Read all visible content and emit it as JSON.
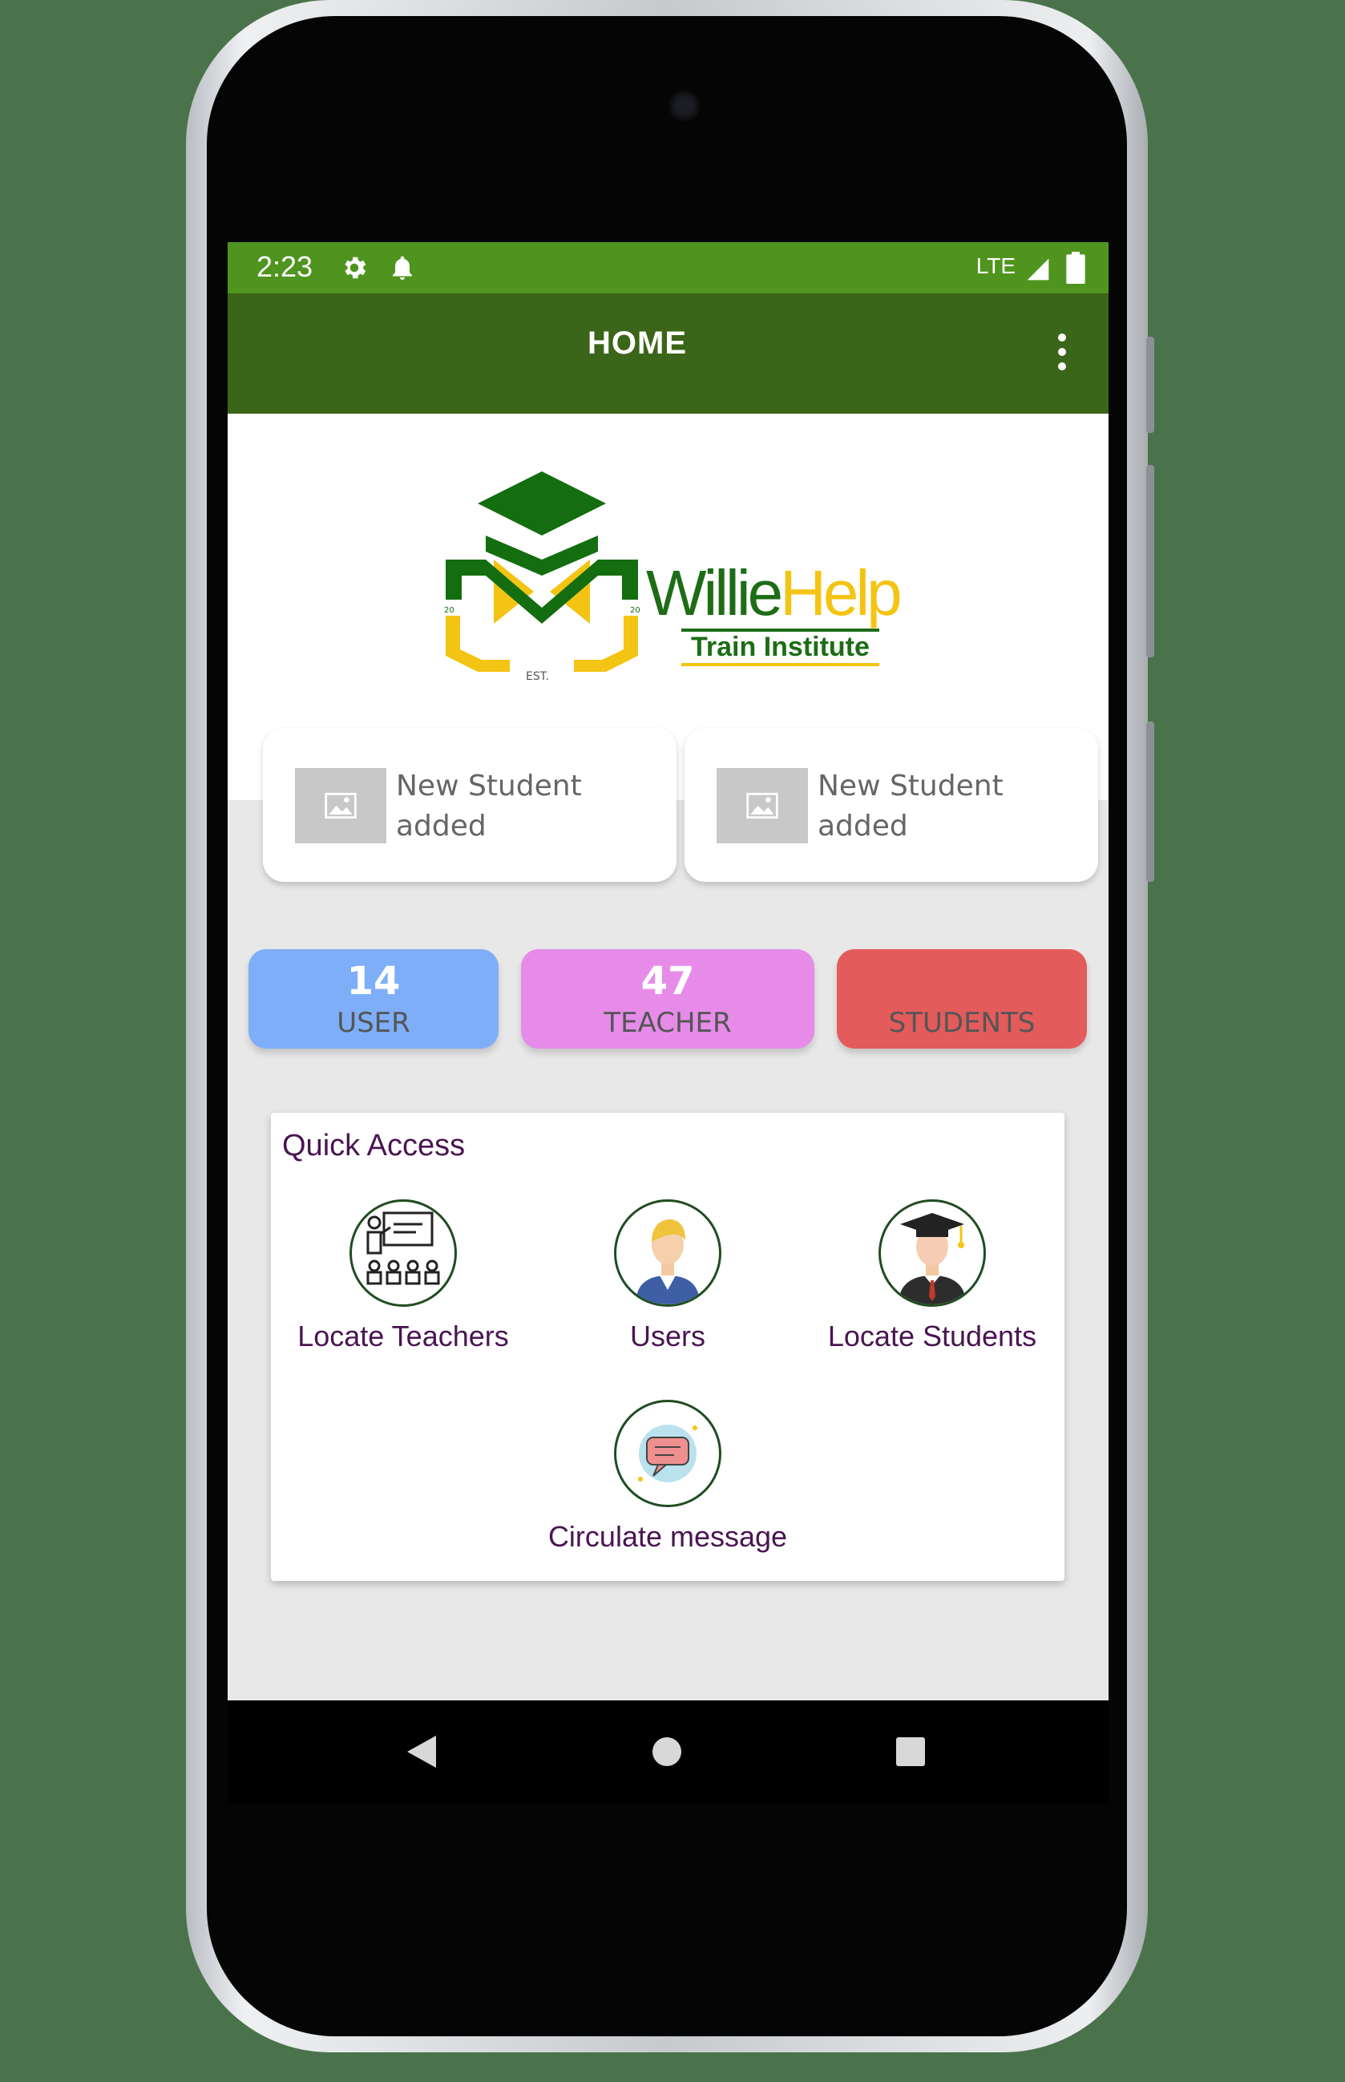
{
  "status_bar": {
    "time": "2:23",
    "network": "LTE",
    "icons": [
      "gear-icon",
      "bell-icon",
      "signal-icon",
      "battery-icon"
    ]
  },
  "app_bar": {
    "title": "HOME",
    "menu_icon": "more-vert-icon"
  },
  "logo": {
    "name_part1": "Willie",
    "name_part2": "Help",
    "subtitle": "Train Institute",
    "est": "EST.",
    "year_left": "20",
    "year_right": "20"
  },
  "recent_cards": [
    {
      "text": "New Student added",
      "thumb_icon": "image-placeholder-icon"
    },
    {
      "text": "New Student added",
      "thumb_icon": "image-placeholder-icon"
    }
  ],
  "stats": [
    {
      "value": "14",
      "label": "USER",
      "color": "#7eaef8"
    },
    {
      "value": "47",
      "label": "TEACHER",
      "color": "#e68ce8"
    },
    {
      "value": "",
      "label": "STUDENTS",
      "color": "#e35b5b"
    }
  ],
  "quick_access": {
    "title": "Quick Access",
    "items": [
      {
        "label": "Locate Teachers",
        "icon": "teacher-class-icon"
      },
      {
        "label": "Users",
        "icon": "user-avatar-icon"
      },
      {
        "label": "Locate Students",
        "icon": "graduate-icon"
      },
      {
        "label": "Circulate message",
        "icon": "chat-bubble-icon"
      }
    ]
  },
  "nav_bar": {
    "icons": [
      "back-icon",
      "home-icon",
      "recents-icon"
    ]
  },
  "colors": {
    "status_bar": "#4f941e",
    "app_bar": "#3b6518",
    "accent_text": "#4a1552",
    "logo_green": "#1d6d16",
    "logo_yellow": "#f4c414"
  }
}
